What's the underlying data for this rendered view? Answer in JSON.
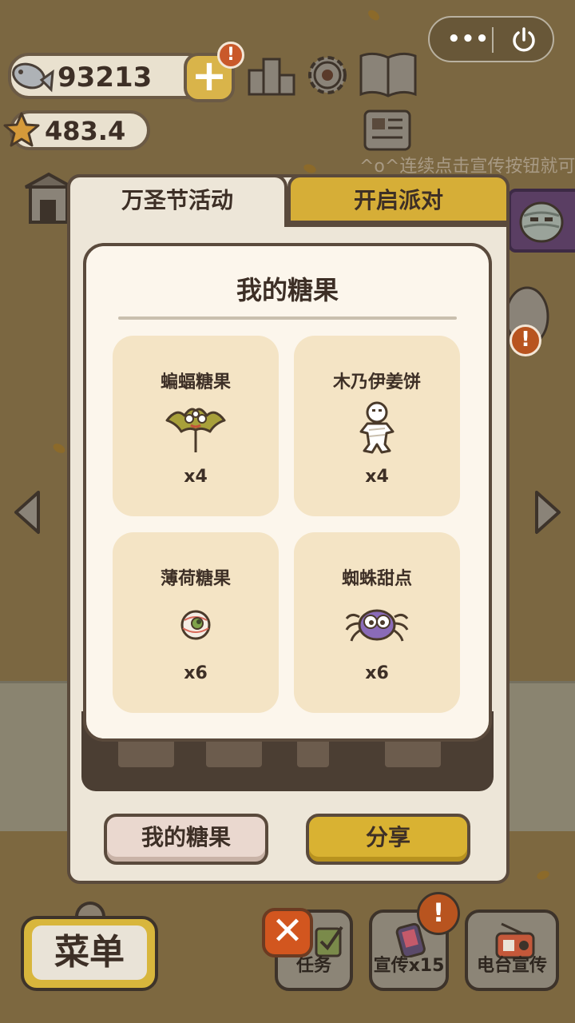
{
  "hud": {
    "fish_count": "93213",
    "star_count": "483.4",
    "plus_label": "+",
    "plus_alert": "!",
    "marquee_text": "^o^连续点击宣传按钮就可",
    "capsule_more": "•••",
    "side_alert": "!"
  },
  "event_panel": {
    "tabs": [
      {
        "label": "万圣节活动",
        "active": true
      },
      {
        "label": "开启派对",
        "active": false
      }
    ],
    "card_title": "我的糖果",
    "items": [
      {
        "name": "蝙蝠糖果",
        "qty": "x4",
        "icon": "bat-candy-icon"
      },
      {
        "name": "木乃伊姜饼",
        "qty": "x4",
        "icon": "mummy-gingerbread-icon"
      },
      {
        "name": "薄荷糖果",
        "qty": "x6",
        "icon": "mint-candy-icon"
      },
      {
        "name": "蜘蛛甜点",
        "qty": "x6",
        "icon": "spider-dessert-icon"
      }
    ],
    "buttons": {
      "my_candy": "我的糖果",
      "share": "分享"
    }
  },
  "dock": {
    "menu": "菜单",
    "close": "✕",
    "tasks": "任务",
    "promote": "宣传x15",
    "promote_alert": "!",
    "radio": "电台宣传"
  },
  "colors": {
    "panel_bg": "#ede6d8",
    "card_bg": "#fcf6ec",
    "item_bg": "#f4e4c5",
    "gold": "#d6ae37",
    "outline": "#5a4a3c",
    "alert": "#c9592a"
  }
}
